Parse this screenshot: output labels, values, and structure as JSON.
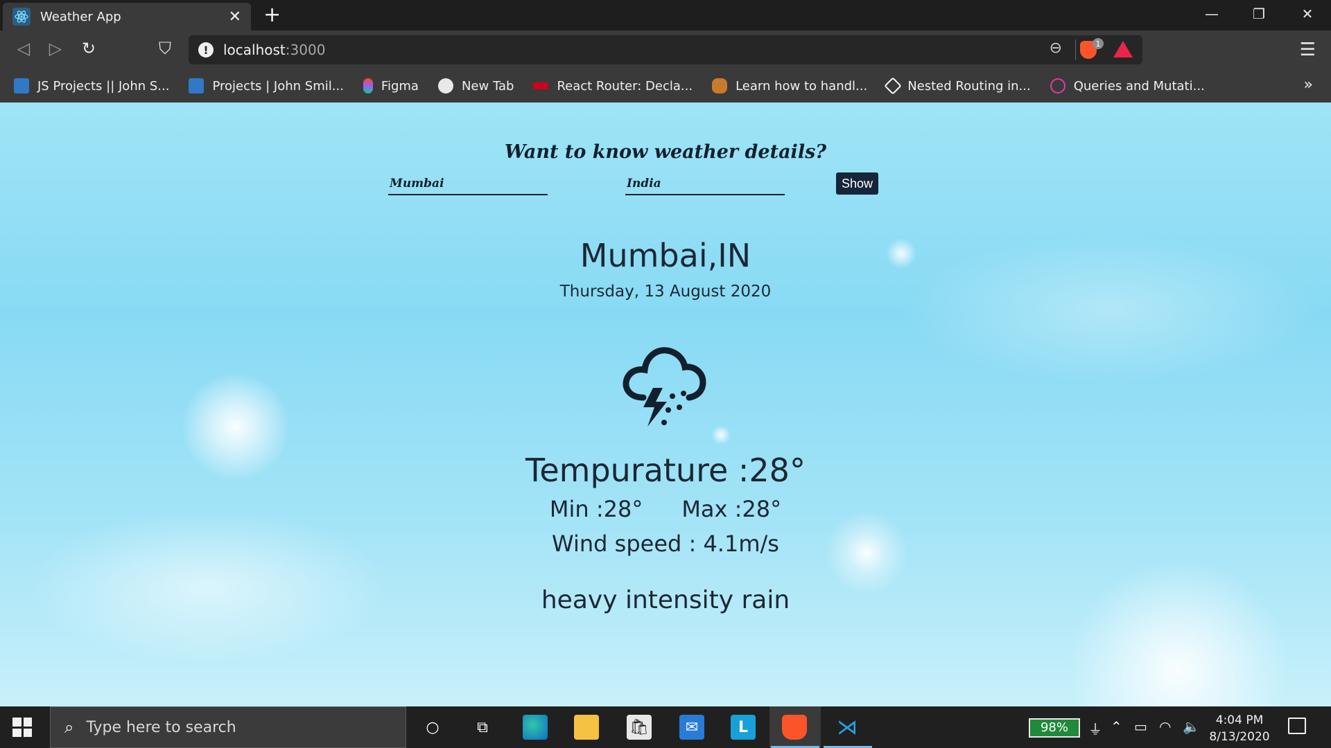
{
  "browser": {
    "tab_title": "Weather App",
    "url_host": "localhost",
    "url_port": ":3000",
    "shield_badge": "1",
    "bookmarks": [
      {
        "label": "JS Projects || John S...",
        "icon": "vue-icon",
        "color": "#3178c6"
      },
      {
        "label": "Projects | John Smil...",
        "icon": "vue-icon",
        "color": "#3178c6"
      },
      {
        "label": "Figma",
        "icon": "figma-icon",
        "color": "#f24e1e"
      },
      {
        "label": "New Tab",
        "icon": "globe-icon",
        "color": "#e8e8e8"
      },
      {
        "label": "React Router: Decla...",
        "icon": "react-router-icon",
        "color": "#d0021b"
      },
      {
        "label": "Learn how to handl...",
        "icon": "owl-icon",
        "color": "#f5a623"
      },
      {
        "label": "Nested Routing in...",
        "icon": "diamond-icon",
        "color": "#ffffff"
      },
      {
        "label": "Queries and Mutati...",
        "icon": "graphql-icon",
        "color": "#e535ab"
      }
    ]
  },
  "weather": {
    "question": "Want to know weather details?",
    "city_value": "Mumbai",
    "country_value": "India",
    "show_label": "Show",
    "location": "Mumbai,IN",
    "date": "Thursday, 13 August 2020",
    "temperature": "Tempurature :28°",
    "min": "Min :28°",
    "max": "Max :28°",
    "wind": "Wind speed : 4.1m/s",
    "description": "heavy intensity rain",
    "icon": "thunderstorm-rain-icon"
  },
  "taskbar": {
    "search_placeholder": "Type here to search",
    "battery": "98%",
    "time": "4:04 PM",
    "date": "8/13/2020"
  },
  "colors": {
    "sky": "#88daf4",
    "text": "#1b2733",
    "button": "#16253a"
  }
}
